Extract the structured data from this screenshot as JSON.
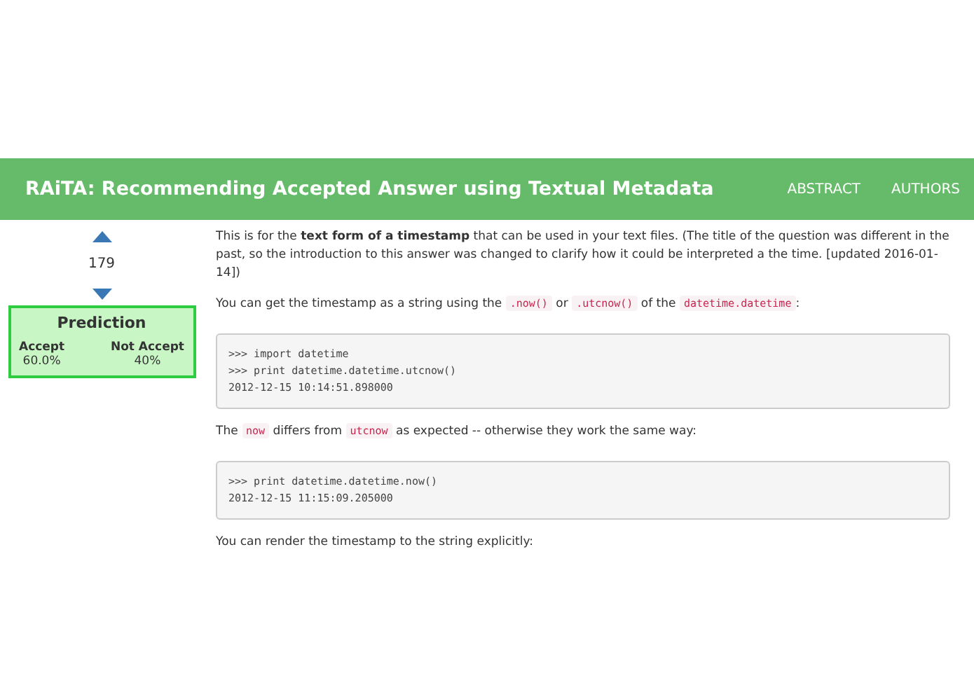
{
  "header": {
    "title": "RAiTA: Recommending Accepted Answer using Textual Metadata",
    "nav": [
      {
        "label": "ABSTRACT"
      },
      {
        "label": "AUTHORS"
      }
    ]
  },
  "votes": {
    "count": "179"
  },
  "prediction": {
    "title": "Prediction",
    "columns": [
      {
        "label": "Accept",
        "value": "60.0%"
      },
      {
        "label": "Not Accept",
        "value": "40%"
      }
    ]
  },
  "answer": [
    {
      "kind": "paragraph",
      "segments": [
        {
          "kind": "text",
          "text": "This is for the **text form of a timestamp** that can be used in your text files. (The title of the question was different in the past, so the introduction to this answer was changed to clarify how it could be interpreted a the time. [updated 2016-01-14])"
        }
      ]
    },
    {
      "kind": "paragraph",
      "segments": [
        {
          "kind": "text",
          "text": "You can get the timestamp as a string using the "
        },
        {
          "kind": "code",
          "text": ".now()"
        },
        {
          "kind": "text",
          "text": " or "
        },
        {
          "kind": "code",
          "text": ".utcnow()"
        },
        {
          "kind": "text",
          "text": " of the "
        },
        {
          "kind": "code",
          "text": "datetime.datetime"
        },
        {
          "kind": "text",
          "text": ":"
        }
      ]
    },
    {
      "kind": "codeblock",
      "lines": [
        ">>> import datetime",
        ">>> print datetime.datetime.utcnow()",
        "2012-12-15 10:14:51.898000"
      ]
    },
    {
      "kind": "paragraph",
      "segments": [
        {
          "kind": "text",
          "text": "The "
        },
        {
          "kind": "code",
          "text": "now"
        },
        {
          "kind": "text",
          "text": " differs from "
        },
        {
          "kind": "code",
          "text": "utcnow"
        },
        {
          "kind": "text",
          "text": " as expected -- otherwise they work the same way:"
        }
      ]
    },
    {
      "kind": "codeblock",
      "lines": [
        ">>> print datetime.datetime.now()",
        "2012-12-15 11:15:09.205000"
      ]
    },
    {
      "kind": "paragraph",
      "segments": [
        {
          "kind": "text",
          "text": "You can render the timestamp to the string explicitly:"
        }
      ]
    }
  ]
}
